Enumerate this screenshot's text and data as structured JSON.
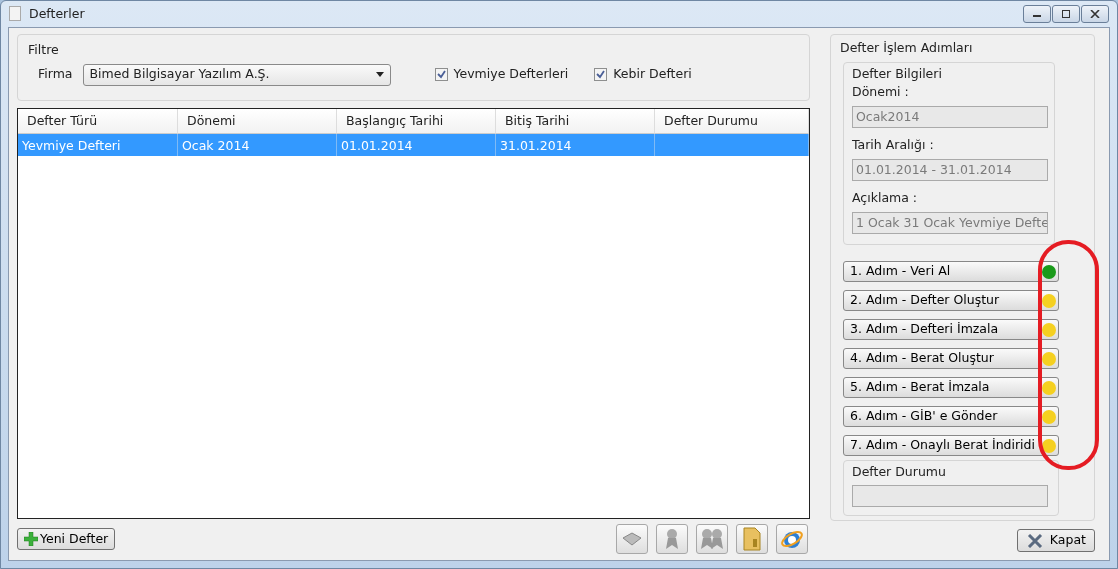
{
  "window": {
    "title": "Defterler"
  },
  "filter": {
    "legend": "Filtre",
    "company_label": "Firma",
    "company_value": "Bimed Bilgisayar Yazılım A.Ş.",
    "checkboxes": [
      {
        "label": "Yevmiye Defterleri",
        "checked": true
      },
      {
        "label": "Kebir Defteri",
        "checked": true
      }
    ]
  },
  "table": {
    "columns": [
      "Defter Türü",
      "Dönemi",
      "Başlangıç Tarihi",
      "Bitiş Tarihi",
      "Defter Durumu"
    ],
    "rows": [
      {
        "cells": [
          "Yevmiye Defteri",
          "Ocak 2014",
          "01.01.2014",
          "31.01.2014"
        ],
        "selected": true
      }
    ]
  },
  "new_button": "Yeni Defter",
  "steps_panel": {
    "legend": "Defter İşlem Adımları",
    "info": {
      "legend": "Defter Bilgileri",
      "fields": [
        {
          "label": "Dönemi :",
          "value": "Ocak2014"
        },
        {
          "label": "Tarih Aralığı :",
          "value": "01.01.2014 - 31.01.2014"
        },
        {
          "label": "Açıklama :",
          "value": "1 Ocak 31 Ocak Yevmiye Defte"
        }
      ]
    },
    "steps": [
      {
        "label": "1. Adım - Veri Al",
        "color": "#1a9a1a"
      },
      {
        "label": "2. Adım - Defter Oluştur",
        "color": "#f5d020"
      },
      {
        "label": "3. Adım - Defteri İmzala",
        "color": "#f5d020"
      },
      {
        "label": "4. Adım - Berat Oluştur",
        "color": "#f5d020"
      },
      {
        "label": "5. Adım - Berat İmzala",
        "color": "#f5d020"
      },
      {
        "label": "6. Adım - GİB' e Gönder",
        "color": "#f5d020"
      },
      {
        "label": "7. Adım - Onaylı Berat İndiridi",
        "color": "#f5d020"
      }
    ],
    "status_legend": "Defter Durumu"
  },
  "close_button": "Kapat"
}
